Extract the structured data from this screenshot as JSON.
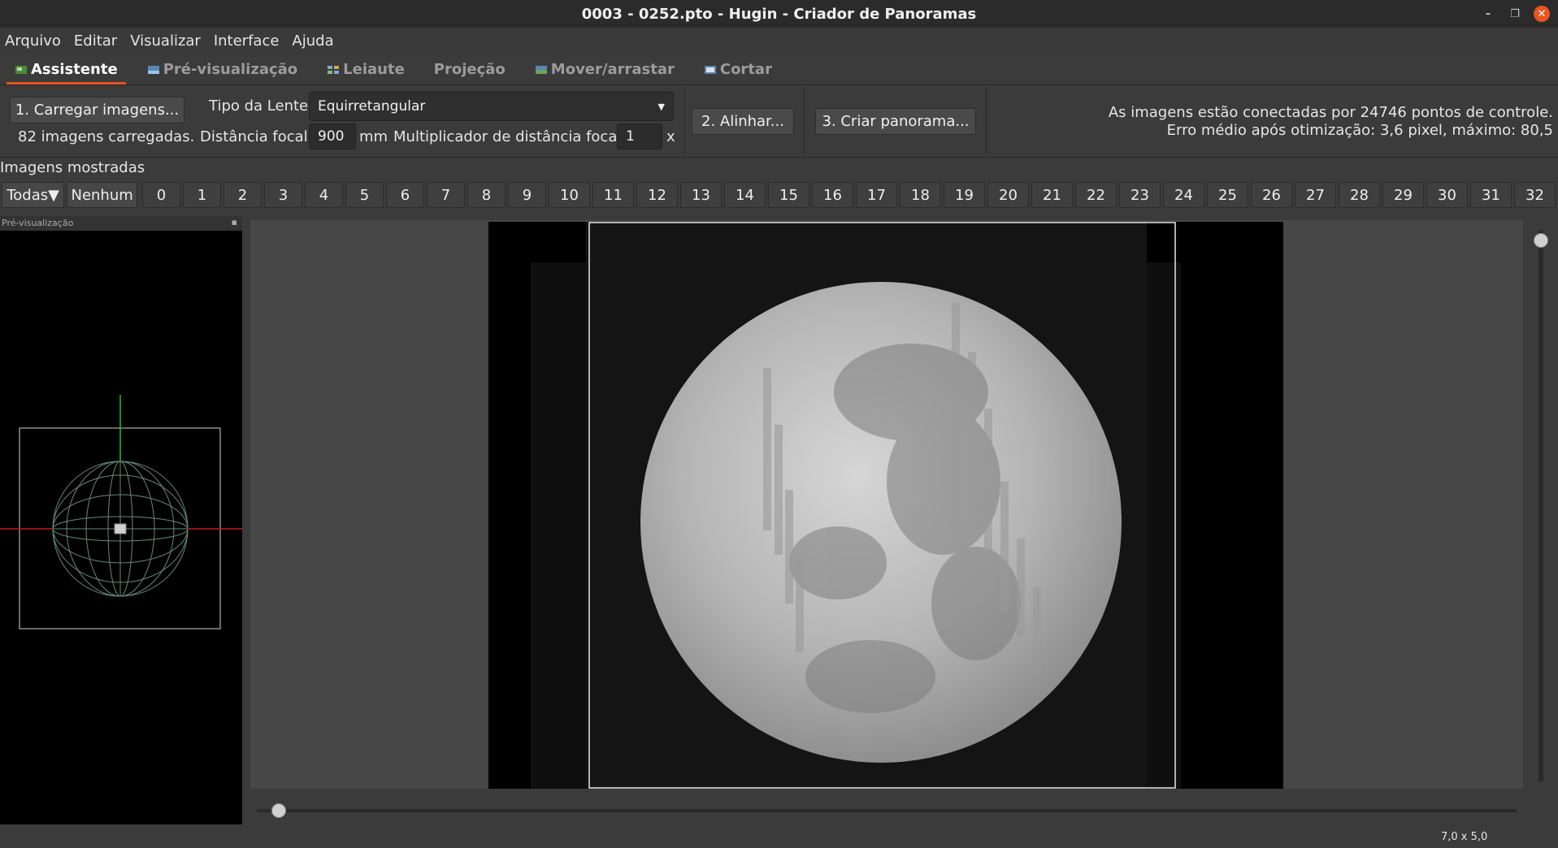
{
  "window": {
    "title": "0003 - 0252.pto - Hugin - Criador de Panoramas"
  },
  "menu": [
    "Arquivo",
    "Editar",
    "Visualizar",
    "Interface",
    "Ajuda"
  ],
  "tabs": [
    {
      "label": "Assistente",
      "icon": "assistant-icon",
      "active": true
    },
    {
      "label": "Pré-visualização",
      "icon": "preview-icon",
      "active": false
    },
    {
      "label": "Leiaute",
      "icon": "layout-icon",
      "active": false
    },
    {
      "label": "Projeção",
      "icon": "",
      "active": false
    },
    {
      "label": "Mover/arrastar",
      "icon": "move-icon",
      "active": false
    },
    {
      "label": "Cortar",
      "icon": "crop-icon",
      "active": false
    }
  ],
  "assistant": {
    "load_button": "1. Carregar imagens...",
    "loaded_count": "82 imagens carregadas.",
    "lens_type_label": "Tipo da Lente:",
    "lens_type_value": "Equirretangular",
    "focal_length_label": "Distância focal:",
    "focal_length_value": "900",
    "focal_length_unit": "mm",
    "multiplier_label": "Multiplicador de distância focal:",
    "multiplier_value": "1",
    "multiplier_unit": "x",
    "align_button": "2. Alinhar...",
    "create_button": "3. Criar panorama...",
    "status_line1": "As imagens estão conectadas por 24746 pontos de controle.",
    "status_line2": "Erro médio após otimização: 3,6 pixel, máximo: 80,5"
  },
  "images_shown": {
    "label": "Imagens mostradas",
    "all_button": "Todas▼",
    "none_button": "Nenhum",
    "numbers": [
      "0",
      "1",
      "2",
      "3",
      "4",
      "5",
      "6",
      "7",
      "8",
      "9",
      "10",
      "11",
      "12",
      "13",
      "14",
      "15",
      "16",
      "17",
      "18",
      "19",
      "20",
      "21",
      "22",
      "23",
      "24",
      "25",
      "26",
      "27",
      "28",
      "29",
      "30",
      "31",
      "32"
    ]
  },
  "overview": {
    "header": "Pré-visualização"
  },
  "status": {
    "fov": "7,0 x 5,0"
  },
  "colors": {
    "accent": "#e95420",
    "background": "#3b3b3b"
  }
}
